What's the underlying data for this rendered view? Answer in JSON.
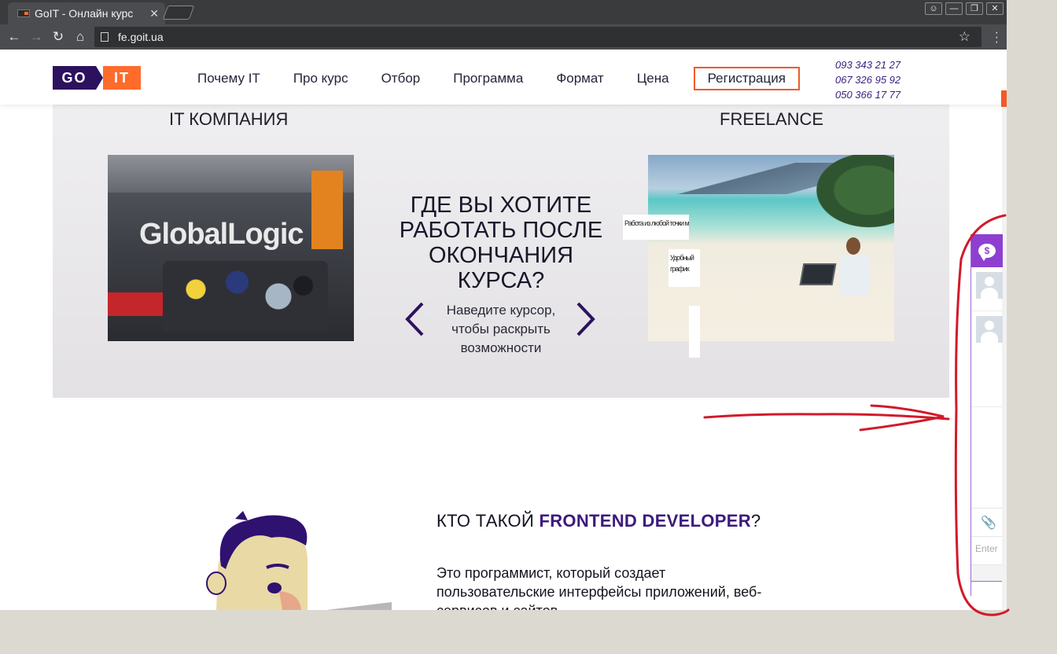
{
  "browser": {
    "tab_title": "GoIT - Онлайн курс",
    "tab_close": "✕",
    "url": "fe.goit.ua",
    "window_buttons": [
      "—",
      "❐",
      "✕"
    ]
  },
  "header": {
    "logo_left": "GO",
    "logo_right": "IT",
    "nav": [
      "Почему IT",
      "Про курс",
      "Отбор",
      "Программа",
      "Формат",
      "Цена"
    ],
    "register_label": "Регистрация",
    "phones": [
      "093 343 21 27",
      "067 326 95 92",
      "050 366 17 77"
    ]
  },
  "career": {
    "left_title": "IT КОМПАНИЯ",
    "left_photo_sign": "GlobalLogic",
    "right_title": "FREELANCE",
    "question": "ГДЕ ВЫ ХОТИТЕ РАБОТАТЬ ПОСЛЕ ОКОНЧАНИЯ КУРСА?",
    "hint": "Наведите курсор, чтобы раскрыть возможности",
    "overlay_text_1": "Работа из любой точки мира",
    "overlay_text_2": "Удобный график"
  },
  "frontend": {
    "title_prefix": "КТО ТАКОЙ ",
    "title_highlight": "FRONTEND DEVELOPER",
    "title_suffix": "?",
    "text": "Это программист, который создает пользовательские интерфейсы приложений, веб-сервисов и сайтов"
  },
  "chat": {
    "icon": "chat-bubble-icon",
    "input_placeholder": "Enter"
  },
  "colors": {
    "brand_purple": "#2c125e",
    "brand_orange": "#ff6b2b",
    "register_border": "#f05a28",
    "chat_purple": "#8e3fcf",
    "annotation_red": "#d11a2a"
  }
}
